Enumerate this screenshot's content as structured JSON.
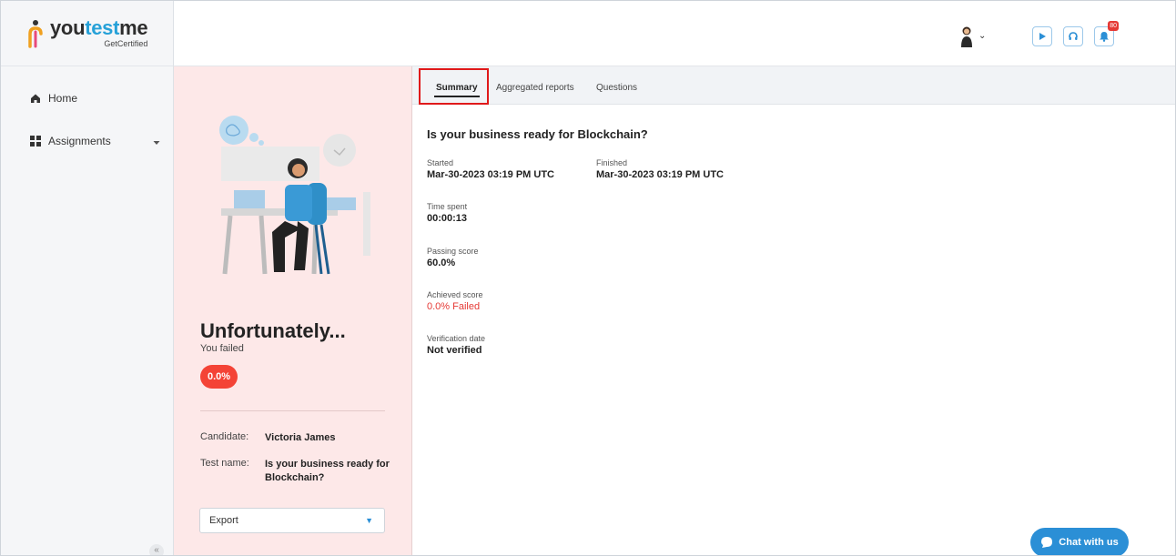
{
  "brand": {
    "name_part1": "you",
    "name_part2": "test",
    "name_part3": "me",
    "subtitle": "GetCertified",
    "accent": "#26a1d8"
  },
  "sidebar": {
    "items": [
      {
        "label": "Home",
        "icon": "home-icon"
      },
      {
        "label": "Assignments",
        "icon": "assignments-icon",
        "expandable": true
      }
    ],
    "collapse_label": "«"
  },
  "topbar": {
    "notification_count": "80"
  },
  "result": {
    "headline": "Unfortunately...",
    "status_text": "You failed",
    "score_pill": "0.0%",
    "candidate_label": "Candidate:",
    "candidate_value": "Victoria James",
    "test_label": "Test name:",
    "test_value": "Is your business ready for Blockchain?",
    "export_label": "Export"
  },
  "tabs": [
    {
      "label": "Summary",
      "active": true
    },
    {
      "label": "Aggregated reports",
      "active": false
    },
    {
      "label": "Questions",
      "active": false
    }
  ],
  "details": {
    "title": "Is your business ready for Blockchain?",
    "started_label": "Started",
    "started_value": "Mar-30-2023 03:19 PM UTC",
    "finished_label": "Finished",
    "finished_value": "Mar-30-2023 03:19 PM UTC",
    "time_spent_label": "Time spent",
    "time_spent_value": "00:00:13",
    "passing_score_label": "Passing score",
    "passing_score_value": "60.0%",
    "achieved_score_label": "Achieved score",
    "achieved_score_value": "0.0% Failed",
    "verification_label": "Verification date",
    "verification_value": "Not verified"
  },
  "chat": {
    "label": "Chat with us"
  },
  "colors": {
    "fail_red": "#e53935",
    "primary_blue": "#2b8fd6",
    "panel_pink": "#fde8e8",
    "highlight_red": "#e0191a"
  }
}
